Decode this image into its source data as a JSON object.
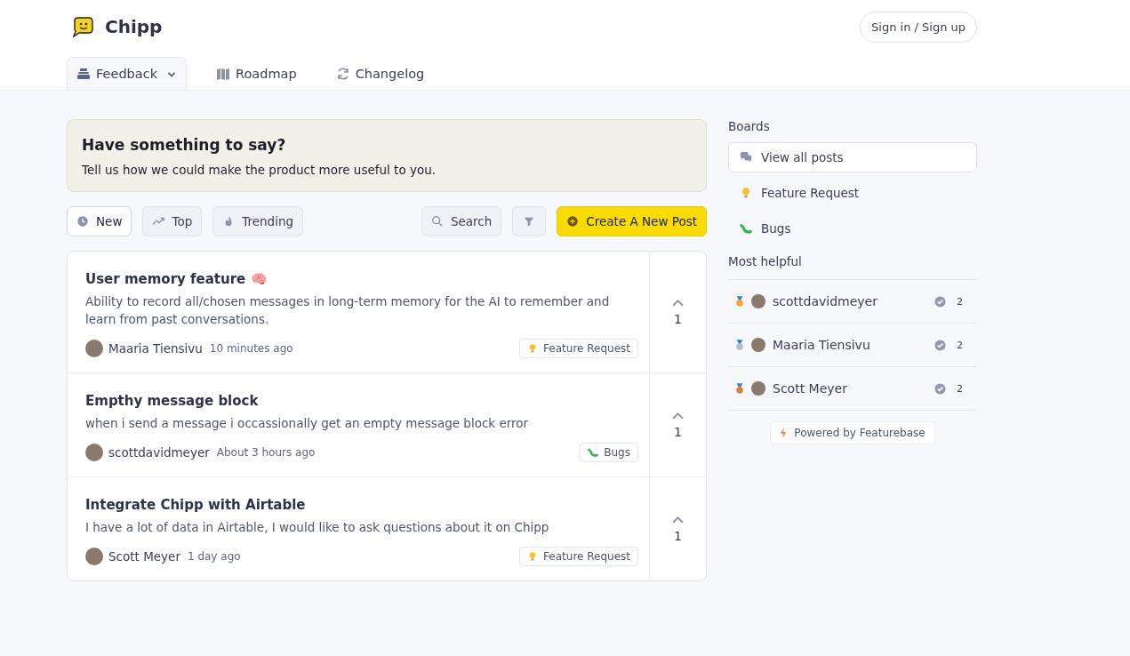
{
  "brand": {
    "name": "Chipp"
  },
  "auth_button": "Sign in / Sign up",
  "nav_tabs": [
    {
      "label": "Feedback",
      "kind": "feedback",
      "selected": true,
      "dropdown": true
    },
    {
      "label": "Roadmap",
      "kind": "roadmap",
      "selected": false,
      "dropdown": false
    },
    {
      "label": "Changelog",
      "kind": "changelog",
      "selected": false,
      "dropdown": false
    }
  ],
  "banner": {
    "title": "Have something to say?",
    "text": "Tell us how we could make the product more useful to you."
  },
  "sort_buttons": [
    {
      "label": "New",
      "kind": "new",
      "selected": true
    },
    {
      "label": "Top",
      "kind": "top",
      "selected": false
    },
    {
      "label": "Trending",
      "kind": "trending",
      "selected": false
    }
  ],
  "search_button": "Search",
  "create_button": "Create A New Post",
  "posts": [
    {
      "title": "User memory feature 🧠",
      "body": "Ability to record all/chosen messages in long-term memory for the AI to remember and learn from past conversations.",
      "author": "Maaria Tiensivu",
      "time": "10 minutes ago",
      "tag": {
        "label": "Feature Request",
        "kind": "idea"
      },
      "votes": "1"
    },
    {
      "title": "Empthy message block",
      "body": "when i send a message i occassionally get an empty message block error",
      "author": "scottdavidmeyer",
      "time": "About 3 hours ago",
      "tag": {
        "label": "Bugs",
        "kind": "bug"
      },
      "votes": "1"
    },
    {
      "title": "Integrate Chipp with Airtable",
      "body": "I have a lot of data in Airtable, I would like to ask questions about it on Chipp",
      "author": "Scott Meyer",
      "time": "1 day ago",
      "tag": {
        "label": "Feature Request",
        "kind": "idea"
      },
      "votes": "1"
    }
  ],
  "sidebar": {
    "boards_title": "Boards",
    "boards": [
      {
        "label": "View all posts",
        "kind": "all",
        "selected": true
      },
      {
        "label": "Feature Request",
        "kind": "idea",
        "selected": false
      },
      {
        "label": "Bugs",
        "kind": "bug",
        "selected": false
      }
    ],
    "helpful_title": "Most helpful",
    "helpful": [
      {
        "name": "scottdavidmeyer",
        "kind": "gold",
        "count": "2"
      },
      {
        "name": "Maaria Tiensivu",
        "kind": "silver",
        "count": "2"
      },
      {
        "name": "Scott Meyer",
        "kind": "bronze",
        "count": "2"
      }
    ],
    "powered_by": "Powered by Featurebase"
  }
}
